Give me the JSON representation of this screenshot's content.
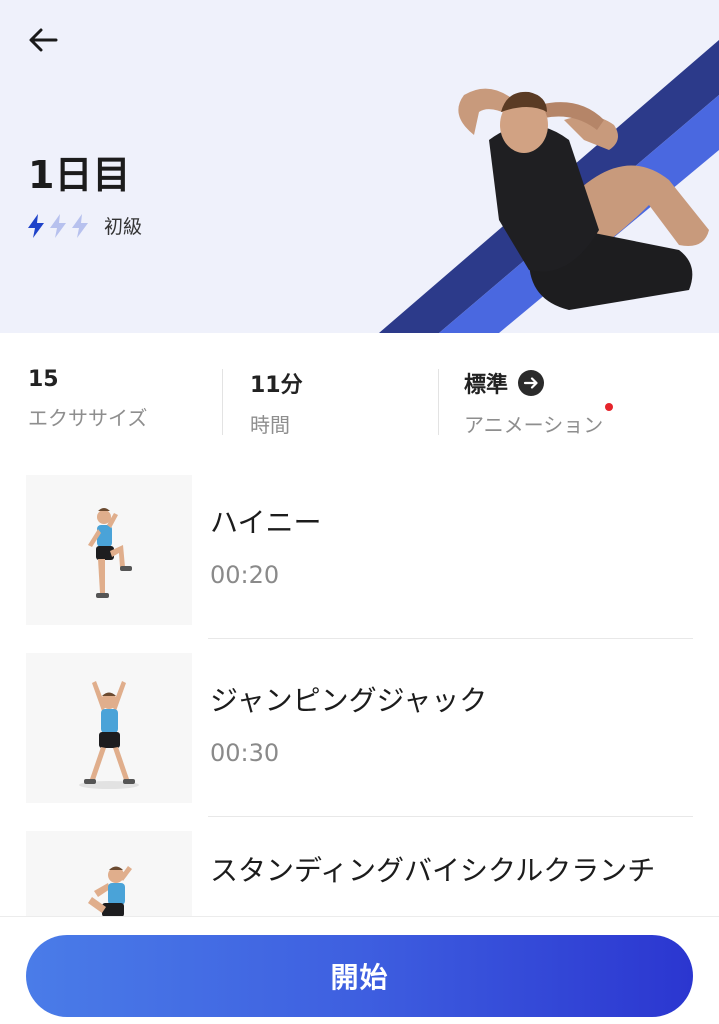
{
  "header": {
    "back_icon": "arrow-left-icon",
    "title": "1日目",
    "level": {
      "label": "初級",
      "rating": 1,
      "max": 3,
      "active_color": "#1f43c9",
      "inactive_color": "#b7c1ee"
    }
  },
  "stats": [
    {
      "value": "15",
      "label": "エクササイズ"
    },
    {
      "value": "11分",
      "label": "時間"
    },
    {
      "value": "標準",
      "label": "アニメーション",
      "icon": "arrow-right-circle-icon",
      "has_notification_dot": true
    }
  ],
  "exercises": [
    {
      "name": "ハイニー",
      "duration": "00:20",
      "figure": "high-knee-figure"
    },
    {
      "name": "ジャンピングジャック",
      "duration": "00:30",
      "figure": "jumping-jack-figure"
    },
    {
      "name": "スタンディングバイシクルクランチ",
      "duration": "",
      "figure": "standing-bicycle-crunch-figure"
    }
  ],
  "footer": {
    "start_label": "開始",
    "gradient": [
      "#4a7ce8",
      "#2b36d0"
    ]
  }
}
